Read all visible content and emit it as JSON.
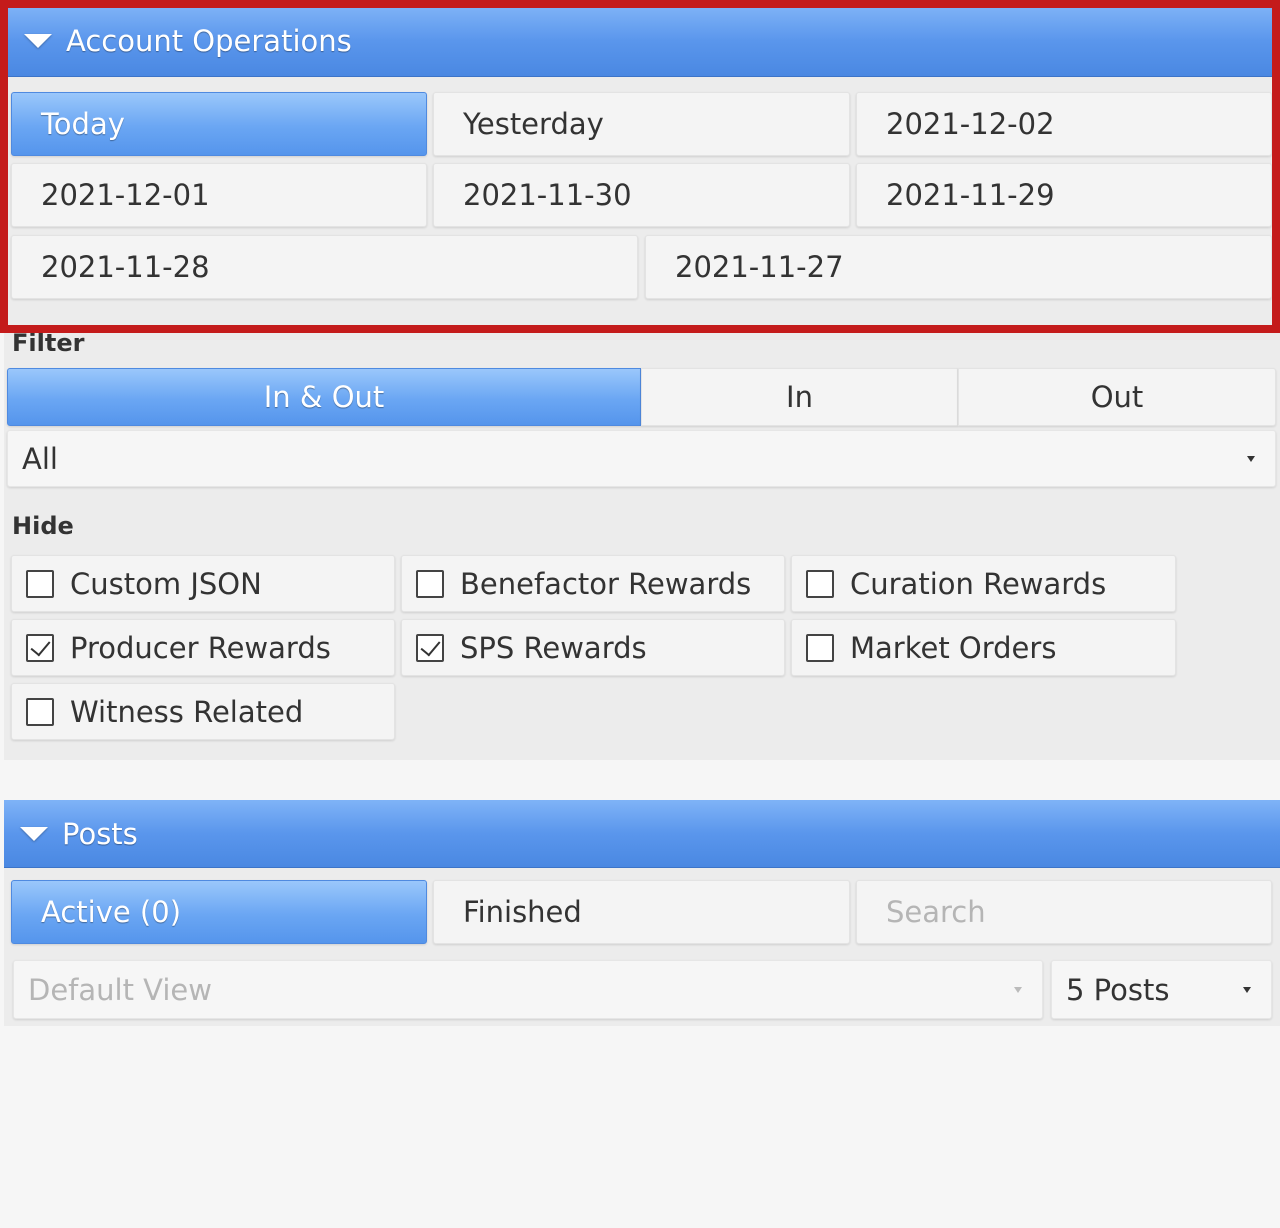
{
  "account_operations": {
    "title": "Account Operations",
    "dates": [
      "Today",
      "Yesterday",
      "2021-12-02",
      "2021-12-01",
      "2021-11-30",
      "2021-11-29",
      "2021-11-28",
      "2021-11-27"
    ],
    "filter_label": "Filter",
    "direction": [
      "In & Out",
      "In",
      "Out"
    ],
    "type_select": "All",
    "hide_label": "Hide",
    "hide_options": [
      {
        "label": "Custom JSON",
        "checked": false
      },
      {
        "label": "Benefactor Rewards",
        "checked": false
      },
      {
        "label": "Curation Rewards",
        "checked": false
      },
      {
        "label": "Producer Rewards",
        "checked": true
      },
      {
        "label": "SPS Rewards",
        "checked": true
      },
      {
        "label": "Market Orders",
        "checked": false
      },
      {
        "label": "Witness Related",
        "checked": false
      }
    ]
  },
  "posts": {
    "title": "Posts",
    "tabs": [
      "Active (0)",
      "Finished"
    ],
    "search_placeholder": "Search",
    "view_select": "Default View",
    "count_select": "5 Posts"
  },
  "colors": {
    "accent": "#5a96ec",
    "highlight_border": "#c41b1b"
  }
}
